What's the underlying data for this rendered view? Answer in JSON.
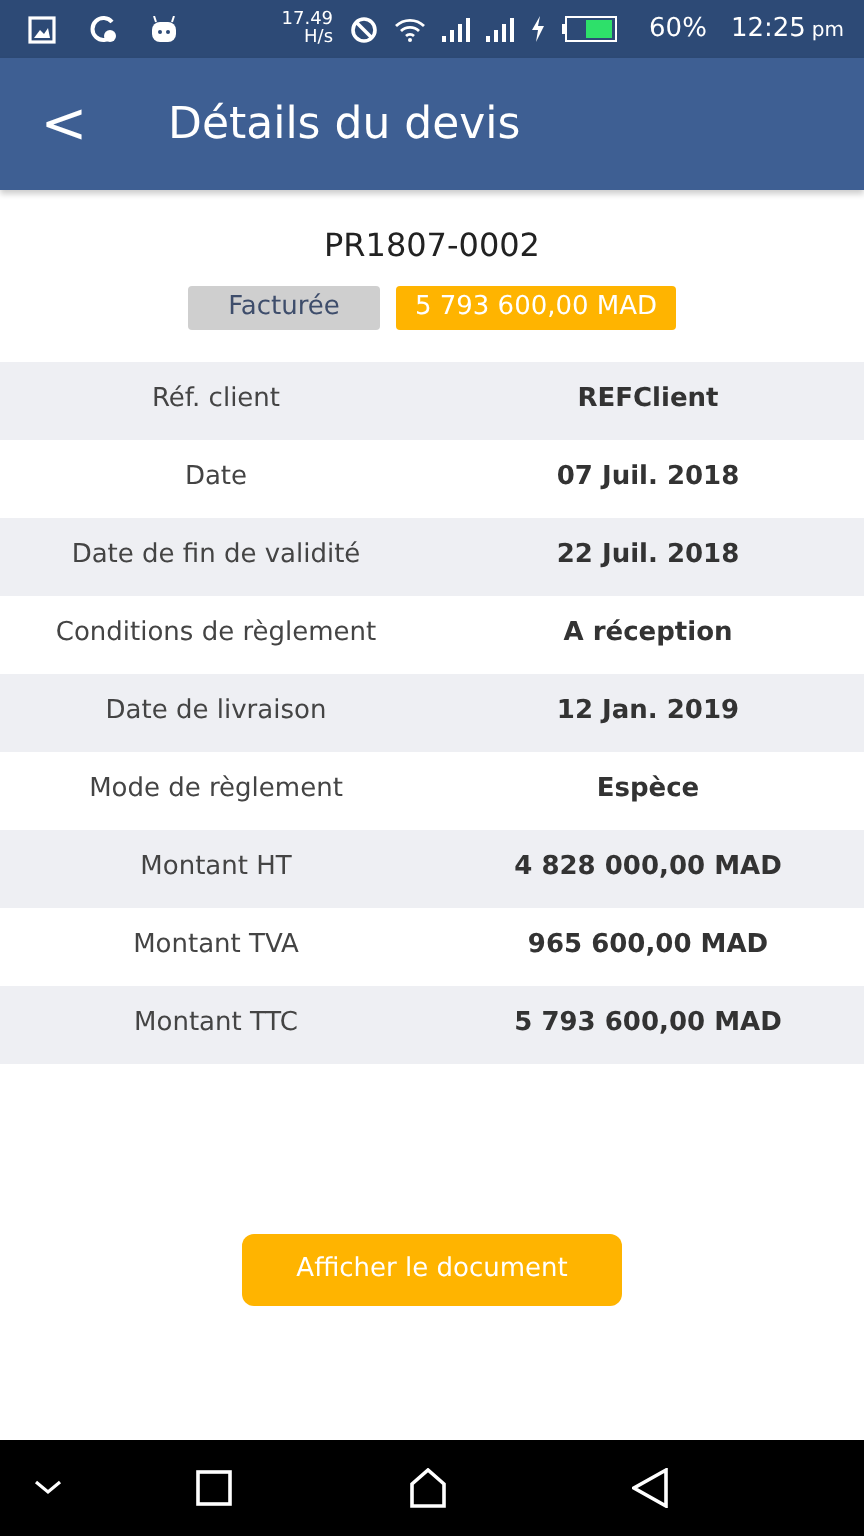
{
  "status_bar": {
    "speed": "17.49",
    "speed_unit": "H/s",
    "battery": "60%",
    "time": "12:25",
    "ampm": "pm"
  },
  "app_bar": {
    "back": "<",
    "title": "Détails du devis"
  },
  "quote": {
    "ref": "PR1807-0002",
    "status": "Facturée",
    "total": "5 793 600,00 MAD"
  },
  "details": [
    {
      "label": "Réf. client",
      "value": "REFClient"
    },
    {
      "label": "Date",
      "value": "07 Juil. 2018"
    },
    {
      "label": "Date de fin de validité",
      "value": "22 Juil. 2018"
    },
    {
      "label": "Conditions de règlement",
      "value": "A réception"
    },
    {
      "label": "Date de livraison",
      "value": "12 Jan. 2019"
    },
    {
      "label": "Mode de règlement",
      "value": "Espèce"
    },
    {
      "label": "Montant HT",
      "value": "4 828 000,00 MAD"
    },
    {
      "label": "Montant TVA",
      "value": "965 600,00 MAD"
    },
    {
      "label": "Montant TTC",
      "value": "5 793 600,00 MAD"
    }
  ],
  "button": "Afficher le document"
}
